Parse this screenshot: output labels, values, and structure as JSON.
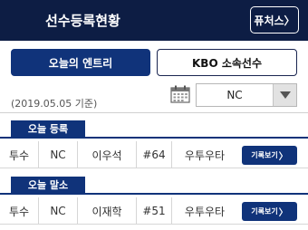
{
  "header": {
    "title": "선수등록현황",
    "futures_label": "퓨처스",
    "futures_chevron": "〉",
    "background_color": "#0d1d44"
  },
  "tabs": [
    {
      "label": "오늘의 엔트리",
      "active": true
    },
    {
      "label": "KBO 소속선수",
      "active": false
    }
  ],
  "date_label": "(2019.05.05 기준)",
  "team_filter": {
    "selected": "NC",
    "icon": "calendar-icon"
  },
  "sections": [
    {
      "badge": "오늘 등록",
      "rows": [
        {
          "position": "투수",
          "team": "NC",
          "name": "이우석",
          "number": "#64",
          "hand": "우투우타",
          "button": "기록보기",
          "chevron": "〉"
        }
      ]
    },
    {
      "badge": "오늘 말소",
      "rows": [
        {
          "position": "투수",
          "team": "NC",
          "name": "이재학",
          "number": "#51",
          "hand": "우투우타",
          "button": "기록보기",
          "chevron": "〉"
        }
      ]
    }
  ],
  "accent_color": "#10337a"
}
